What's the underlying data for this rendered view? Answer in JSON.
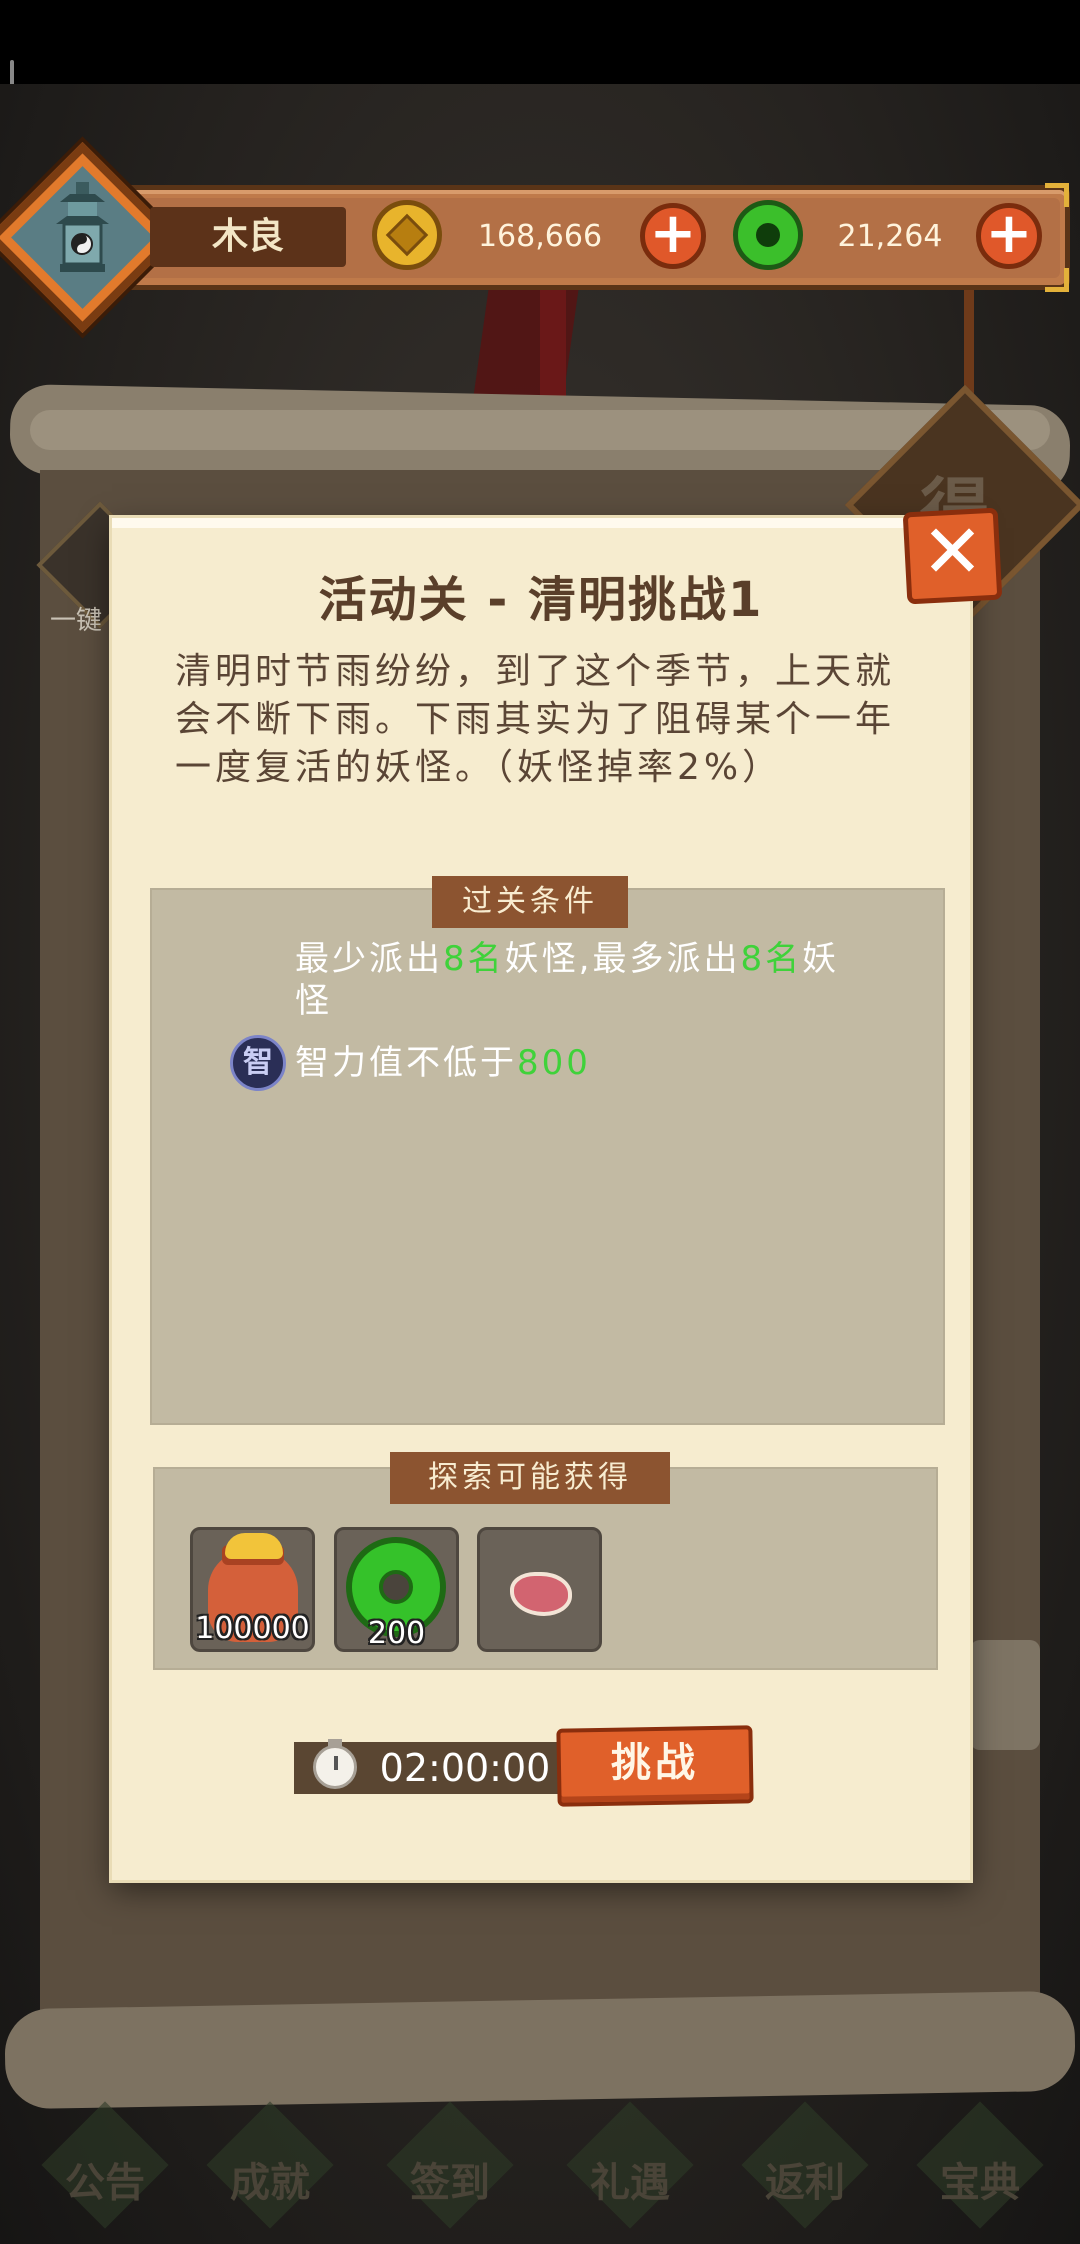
{
  "player": {
    "name": "木良"
  },
  "currency": {
    "gold": "168,666",
    "jade": "21,264",
    "plus_symbol": "+"
  },
  "dialog": {
    "title": "活动关 - 清明挑战1",
    "description": "清明时节雨纷纷，到了这个季节，上天就会不断下雨。下雨其实为了阻碍某个一年一度复活的妖怪。（妖怪掉率2%）",
    "close_symbol": "✕",
    "conditions": {
      "tab_label": "过关条件",
      "line1": {
        "p1": "最少派出",
        "n1": "8名",
        "p2": "妖怪,最多派出",
        "n2": "8名",
        "p3": "妖怪"
      },
      "intelligence": {
        "badge": "智",
        "prefix": "智力值不低于",
        "value": "800"
      }
    },
    "rewards": {
      "tab_label": "探索可能获得",
      "items": [
        {
          "icon": "gold-bag-icon",
          "quantity": "100000"
        },
        {
          "icon": "jade-coin-icon",
          "quantity": "200"
        },
        {
          "icon": "meat-icon",
          "quantity": ""
        }
      ]
    },
    "timer": "02:00:00",
    "challenge_label": "挑战"
  },
  "background": {
    "left_text": "一键",
    "right_sign_char": "得",
    "nav": [
      "公告",
      "成就",
      "签到",
      "礼遇",
      "返利",
      "宝典"
    ]
  },
  "colors": {
    "accent": "#e0602a",
    "highlight": "#3fd23a",
    "dialog_bg": "#f6eccf",
    "panel_bg": "#c2baa3",
    "tab_bg": "#8c5430"
  }
}
